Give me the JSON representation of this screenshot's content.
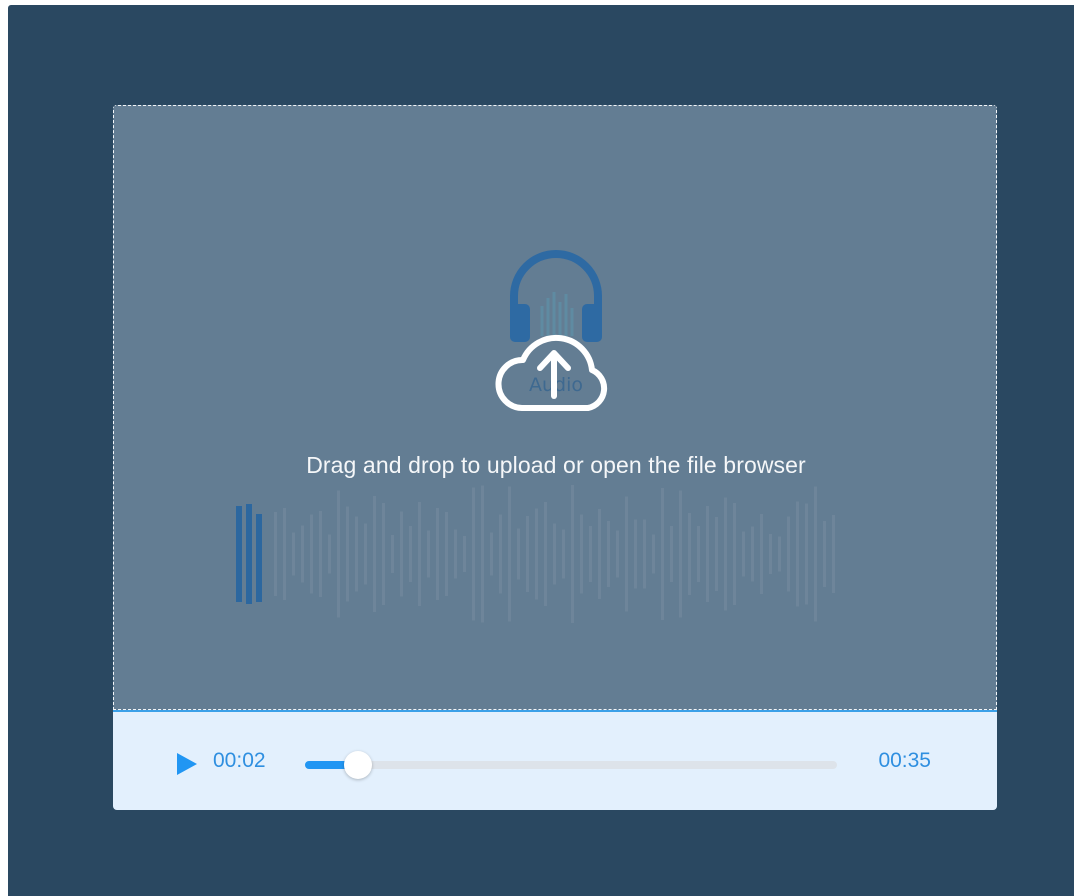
{
  "dropzone": {
    "hint_text": "Drag and drop to upload or open the file browser",
    "ghost_label": "Audio",
    "icons": [
      "headphones-icon",
      "upload-cloud-icon",
      "waveform-placeholder"
    ]
  },
  "player": {
    "current_time": "00:02",
    "total_time": "00:35",
    "progress": 0.1,
    "icons": [
      "play-icon"
    ]
  },
  "colors": {
    "background": "#2a4861",
    "dropzone": "#637d93",
    "player_bg": "#e3f0fd",
    "accent": "#2196f3",
    "icon_blue": "#2f6ea6"
  }
}
